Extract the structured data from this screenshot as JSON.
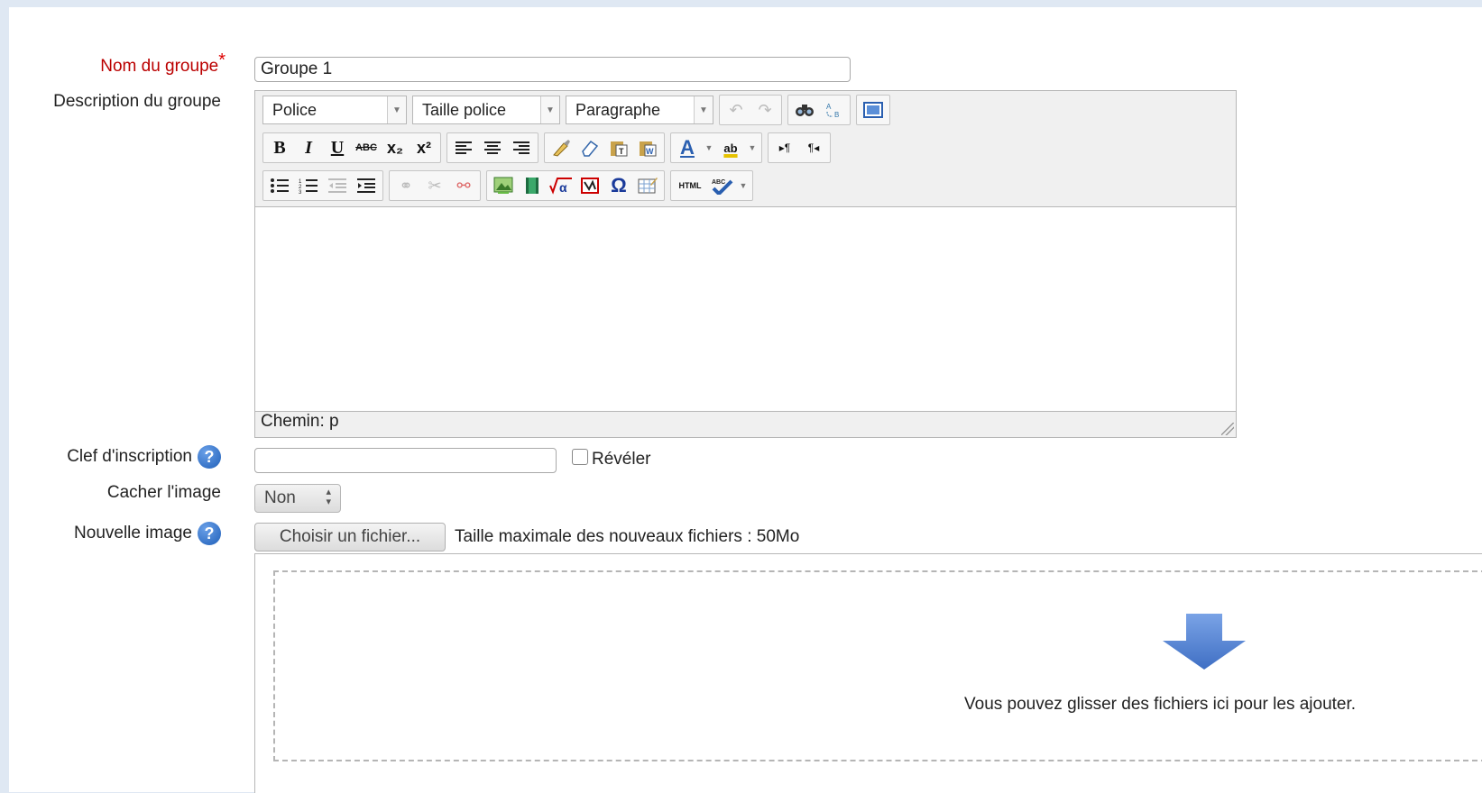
{
  "form": {
    "group_name": {
      "label": "Nom du groupe",
      "required_mark": "*",
      "value": "Groupe 1"
    },
    "group_description": {
      "label": "Description du groupe",
      "toolbar": {
        "font_select": "Police",
        "size_select": "Taille police",
        "format_select": "Paragraphe",
        "bold": "B",
        "italic": "I",
        "underline": "U",
        "strikethrough": "ABC",
        "subscript": "x₂",
        "superscript": "x²",
        "font_color": "A",
        "highlight": "ab",
        "ltr": "▸¶",
        "rtl": "¶◂",
        "omega": "Ω",
        "html": "HTML"
      },
      "path_label": "Chemin: p"
    },
    "enrolment_key": {
      "label": "Clef d'inscription",
      "value": "",
      "reveal_label": "Révéler"
    },
    "hide_picture": {
      "label": "Cacher l'image",
      "value": "Non"
    },
    "new_picture": {
      "label": "Nouvelle image",
      "choose_button": "Choisir un fichier...",
      "max_size": "Taille maximale des nouveaux fichiers : 50Mo",
      "drop_text": "Vous pouvez glisser des fichiers ici pour les ajouter."
    }
  },
  "icons": {
    "help": "help-icon",
    "undo": "undo-icon",
    "redo": "redo-icon",
    "find": "find-icon",
    "replace": "replace-icon",
    "fullscreen": "fullscreen-icon",
    "drop_arrow": "down-arrow-icon"
  },
  "colors": {
    "required": "#cc0000",
    "help_blue": "#2a6bc8",
    "drop_arrow": "#4f7fd4"
  }
}
